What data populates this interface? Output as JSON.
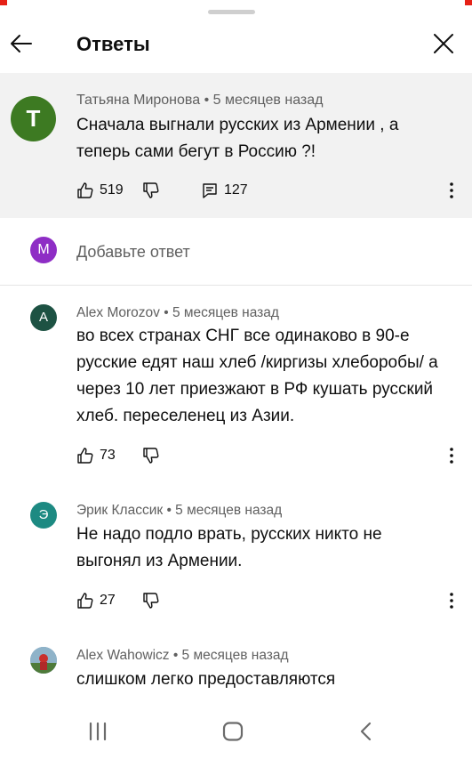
{
  "header": {
    "title": "Ответы"
  },
  "pinned_comment": {
    "avatar_letter": "Т",
    "avatar_color": "#3d7a22",
    "author": "Татьяна Миронова",
    "time": "• 5 месяцев назад",
    "text": "Сначала выгнали русских из Армении , а теперь сами бегут в Россию ?!",
    "likes": "519",
    "replies": "127"
  },
  "add_reply": {
    "avatar_letter": "M",
    "avatar_color": "#8e2dc5",
    "placeholder": "Добавьте ответ"
  },
  "replies": [
    {
      "avatar_letter": "A",
      "avatar_color": "#1d5243",
      "author": "Alex Morozov",
      "time": "• 5 месяцев назад",
      "text": "во всех странах СНГ все одинаково в 90-е русские едят наш хлеб /киргизы хлеборобы/ а через 10 лет приезжают в РФ кушать русский хлеб. переселенец из Азии.",
      "likes": "73"
    },
    {
      "avatar_letter": "Э",
      "avatar_color": "#1d8a82",
      "author": "Эрик Классик",
      "time": "• 5 месяцев назад",
      "text": "Не надо подло врать, русских никто не выгонял из Армении.",
      "likes": "27"
    },
    {
      "author": "Alex Wahowicz",
      "time": "• 5 месяцев назад",
      "text": "слишком легко предоставляются"
    }
  ]
}
